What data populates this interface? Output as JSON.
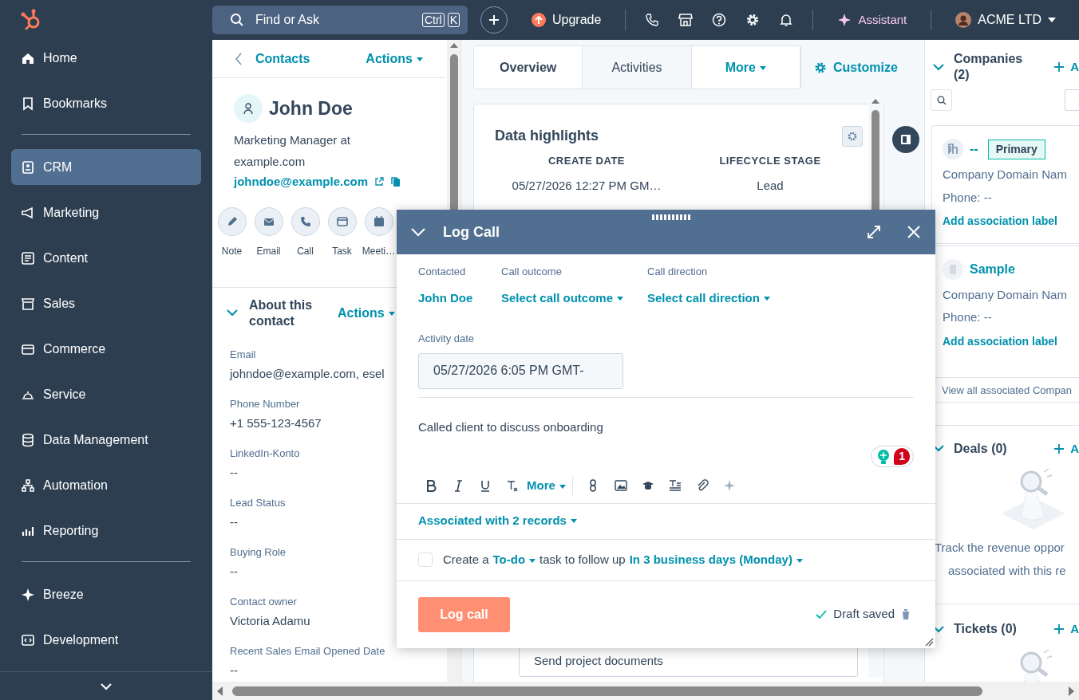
{
  "sidebar": {
    "items": [
      {
        "label": "Home",
        "selected": false
      },
      {
        "label": "Bookmarks",
        "selected": false
      },
      {
        "label": "CRM",
        "selected": true
      },
      {
        "label": "Marketing",
        "selected": false
      },
      {
        "label": "Content",
        "selected": false
      },
      {
        "label": "Sales",
        "selected": false
      },
      {
        "label": "Commerce",
        "selected": false
      },
      {
        "label": "Service",
        "selected": false
      },
      {
        "label": "Data Management",
        "selected": false
      },
      {
        "label": "Automation",
        "selected": false
      },
      {
        "label": "Reporting",
        "selected": false
      },
      {
        "label": "Breeze",
        "selected": false
      },
      {
        "label": "Development",
        "selected": false
      }
    ]
  },
  "topbar": {
    "search": {
      "placeholder": "Find or Ask",
      "keys": [
        "Ctrl",
        "K"
      ]
    },
    "upgrade": "Upgrade",
    "assistant": "Assistant",
    "account": "ACME LTD"
  },
  "contact": {
    "back": "Contacts",
    "actions": "Actions",
    "name": "John Doe",
    "title": "Marketing Manager at example.com",
    "email": "johndoe@example.com",
    "quick_actions": [
      "Note",
      "Email",
      "Call",
      "Task",
      "Meeti…"
    ]
  },
  "about": {
    "title": "About this contact",
    "actions": "Actions",
    "properties": [
      {
        "label": "Email",
        "value": "johndoe@example.com, esel"
      },
      {
        "label": "Phone Number",
        "value": "+1 555-123-4567"
      },
      {
        "label": "LinkedIn-Konto",
        "value": "--"
      },
      {
        "label": "Lead Status",
        "value": "--"
      },
      {
        "label": "Buying Role",
        "value": "--"
      },
      {
        "label": "Contact owner",
        "value": "Victoria Adamu"
      },
      {
        "label": "Recent Sales Email Opened Date",
        "value": "--"
      }
    ]
  },
  "tabs": [
    {
      "label": "Overview",
      "selected": true,
      "kind": "tab"
    },
    {
      "label": "Activities",
      "selected": false,
      "kind": "tab"
    },
    {
      "label": "More",
      "selected": false,
      "kind": "dropdown"
    }
  ],
  "customize": "Customize",
  "data_highlights": {
    "title": "Data highlights",
    "columns": [
      {
        "label": "CREATE DATE",
        "value": "05/27/2026 12:27 PM GM…"
      },
      {
        "label": "LIFECYCLE STAGE",
        "value": "Lead"
      }
    ]
  },
  "task_preview": "Send project documents",
  "log_call": {
    "title": "Log Call",
    "fields": [
      {
        "label": "Contacted",
        "value": "John Doe",
        "kind": "text"
      },
      {
        "label": "Call outcome",
        "value": "Select call outcome",
        "kind": "dropdown"
      },
      {
        "label": "Call direction",
        "value": "Select call direction",
        "kind": "dropdown"
      }
    ],
    "activity_date": {
      "label": "Activity date",
      "value": "05/27/2026 6:05 PM GMT-"
    },
    "body": "Called client to discuss onboarding",
    "suggestion_count": "1",
    "toolbar_more": "More",
    "associated": "Associated with 2 records",
    "followup": {
      "checked": false,
      "parts": [
        "Create a",
        "To-do",
        "task to follow up",
        "In 3 business days (Monday)"
      ]
    },
    "submit": "Log call",
    "draft_status": "Draft saved"
  },
  "companies": {
    "title": "Companies (2)",
    "add": "A",
    "items": [
      {
        "name": "--",
        "badge": "Primary",
        "domain": "Company Domain Nam",
        "phone": "Phone: --",
        "link": "Add association label"
      },
      {
        "name": "Sample",
        "domain": "Company Domain Nam",
        "phone": "Phone: --",
        "link": "Add association label"
      }
    ],
    "view_all": "View all associated Compan"
  },
  "deals": {
    "title": "Deals (0)",
    "add": "A",
    "empty_lines": [
      "Track the revenue oppor",
      "associated with this re"
    ]
  },
  "tickets": {
    "title": "Tickets (0)",
    "add": "A"
  }
}
